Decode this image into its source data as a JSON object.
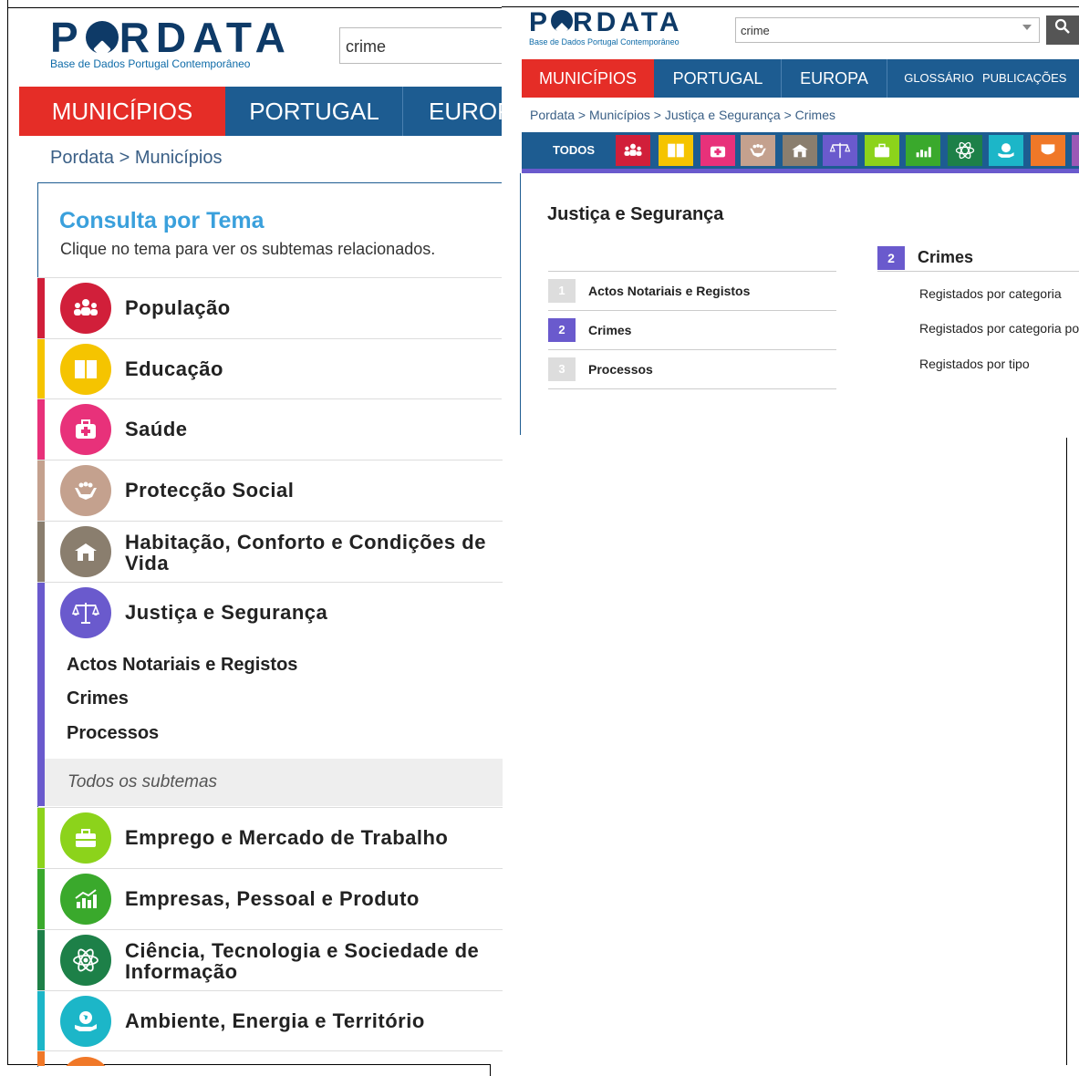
{
  "left": {
    "logo": {
      "word_a": "P",
      "word_b": "RDATA",
      "subtitle": "Base de Dados Portugal Contemporâneo"
    },
    "search": {
      "value": "crime"
    },
    "nav": [
      "MUNICÍPIOS",
      "PORTUGAL",
      "EUROP"
    ],
    "breadcrumb": "Pordata > Municípios",
    "consult": {
      "title": "Consulta por Tema",
      "subtitle": "Clique no tema para ver os subtemas relacionados."
    },
    "themes": [
      {
        "label": "População",
        "color": "#d11f3a",
        "icon": "population-icon"
      },
      {
        "label": "Educação",
        "color": "#f5c400",
        "icon": "book-icon"
      },
      {
        "label": "Saúde",
        "color": "#e8317a",
        "icon": "medical-bag-icon"
      },
      {
        "label": "Protecção Social",
        "color": "#c4a18e",
        "icon": "hands-icon"
      },
      {
        "label": "Habitação, Conforto e Condições de Vida",
        "color": "#8a7e6e",
        "icon": "house-icon"
      },
      {
        "label": "Justiça e Segurança",
        "color": "#6a5acd",
        "icon": "scales-icon"
      },
      {
        "label": "Emprego e Mercado de Trabalho",
        "color": "#8cd31b",
        "icon": "briefcase-icon"
      },
      {
        "label": "Empresas, Pessoal e Produto",
        "color": "#3aa92c",
        "icon": "chart-icon"
      },
      {
        "label": "Ciência, Tecnologia e Sociedade de Informação",
        "color": "#1d8048",
        "icon": "atom-icon"
      },
      {
        "label": "Ambiente, Energia e Território",
        "color": "#1cb6c8",
        "icon": "globe-hand-icon"
      }
    ],
    "subthemes": [
      "Actos Notariais e Registos",
      "Crimes",
      "Processos"
    ],
    "all_subthemes": "Todos os subtemas"
  },
  "right": {
    "logo": {
      "word_a": "P",
      "word_b": "RDATA",
      "subtitle": "Base de Dados Portugal Contemporâneo"
    },
    "search": {
      "value": "crime"
    },
    "nav": [
      "MUNICÍPIOS",
      "PORTUGAL",
      "EUROPA",
      "GLOSSÁRIO",
      "PUBLICAÇÕES"
    ],
    "breadcrumb": "Pordata > Municípios > Justiça e Segurança > Crimes",
    "todos": "TODOS",
    "icon_colors": [
      "#d11f3a",
      "#f5c400",
      "#e8317a",
      "#c4a18e",
      "#8a7e6e",
      "#6a5acd",
      "#8cd31b",
      "#3aa92c",
      "#1d8048",
      "#1cb6c8",
      "#f07828"
    ],
    "section_title": "Justiça e Segurança",
    "subthemes": [
      {
        "num": "1",
        "label": "Actos Notariais e Registos",
        "active": false
      },
      {
        "num": "2",
        "label": "Crimes",
        "active": true
      },
      {
        "num": "3",
        "label": "Processos",
        "active": false
      }
    ],
    "detail": {
      "num": "2",
      "title": "Crimes",
      "links": [
        "Registados por categoria",
        "Registados por categoria po",
        "Registados por tipo"
      ]
    }
  }
}
